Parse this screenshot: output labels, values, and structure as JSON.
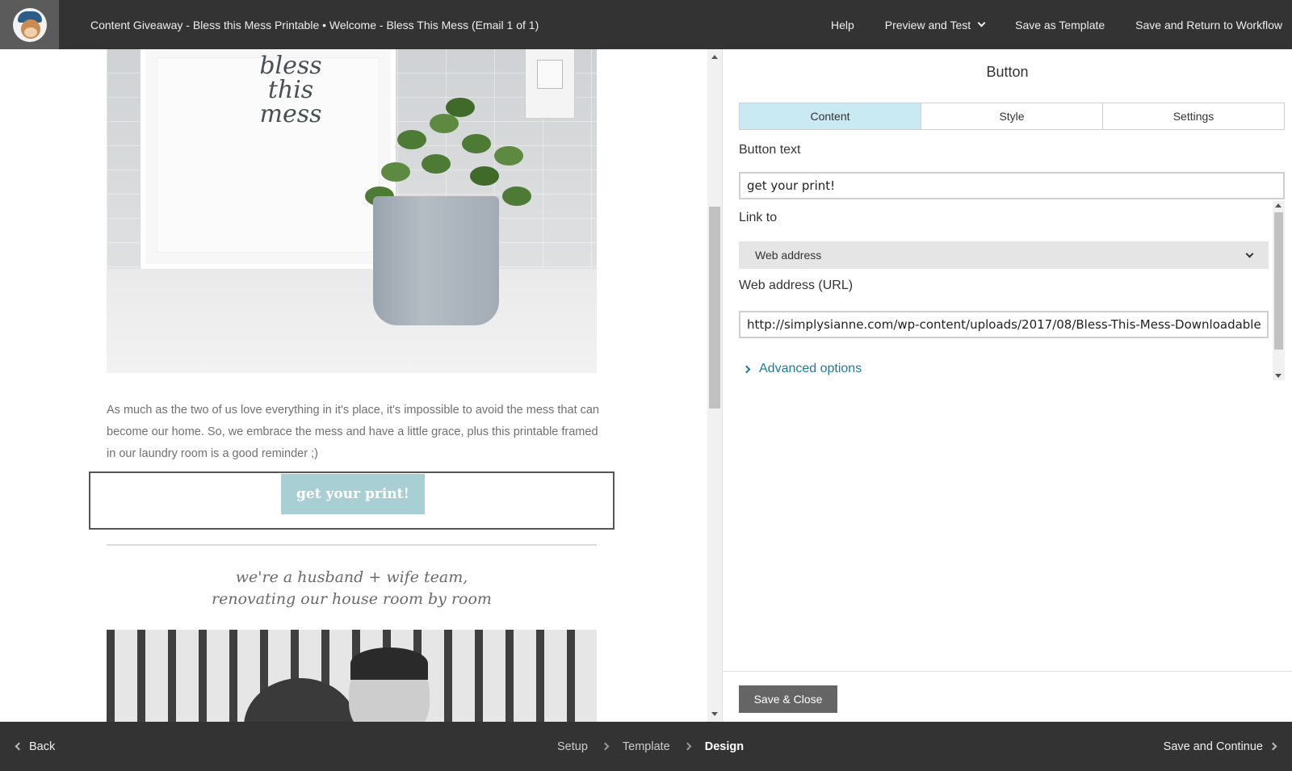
{
  "header": {
    "title": "Content Giveaway - Bless this Mess Printable • Welcome - Bless This Mess (Email 1 of 1)",
    "logo_icon": "mailchimp-logo-icon",
    "actions": {
      "help": "Help",
      "preview_and_test": "Preview and Test",
      "save_as_template": "Save as Template",
      "save_and_return": "Save and Return to Workflow"
    }
  },
  "preview": {
    "frame_text": "bless\nthis\nmess",
    "paragraph": "As much as the two of us love everything in it's place, it's impossible to avoid the mess that can become our home. So, we embrace the mess and have a little grace, plus this printable framed in our laundry room is a good reminder ;)",
    "cta_label": "get your print!",
    "tagline_line1": "we're a husband + wife team,",
    "tagline_line2": "renovating our house room by room"
  },
  "editor": {
    "title": "Button",
    "tabs": [
      {
        "label": "Content",
        "active": true
      },
      {
        "label": "Style",
        "active": false
      },
      {
        "label": "Settings",
        "active": false
      }
    ],
    "button_text_label": "Button text",
    "button_text_value": "get your print!",
    "link_to_label": "Link to",
    "link_to_selected": "Web address",
    "url_label": "Web address (URL)",
    "url_value": "http://simplysianne.com/wp-content/uploads/2017/08/Bless-This-Mess-Downloadable",
    "advanced_options": "Advanced options",
    "save_close": "Save & Close"
  },
  "footer": {
    "back": "Back",
    "steps": [
      "Setup",
      "Template",
      "Design"
    ],
    "current_step": "Design",
    "save_continue": "Save and Continue"
  },
  "colors": {
    "topbar_bg": "#333333",
    "cta_button": "#a8d0d4",
    "active_tab": "#c9e9f3",
    "link": "#1f7a9a"
  }
}
